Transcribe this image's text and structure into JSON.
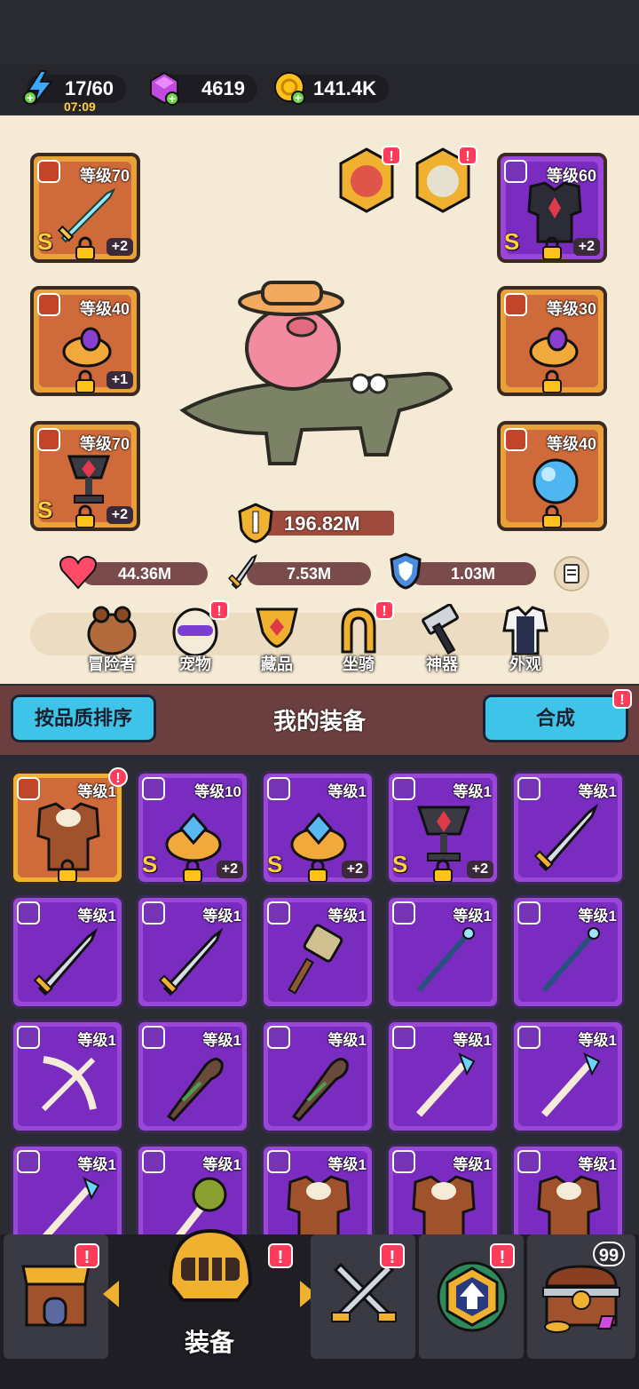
{
  "colors": {
    "accent_blue": "#3ec4e8",
    "purple_rarity": "#9a47d8",
    "orange_rarity": "#e9a13a",
    "alert_red": "#ff3b5c"
  },
  "resources": {
    "energy": {
      "value": "17/60",
      "timer": "07:09",
      "icon": "lightning-icon"
    },
    "gems": {
      "value": "4619",
      "icon": "gem-icon"
    },
    "gold": {
      "value": "141.4K",
      "icon": "coin-icon"
    }
  },
  "equipped": {
    "left": [
      {
        "level": "等级70",
        "rarity": "S",
        "plus": "+2",
        "type": "sword-icon"
      },
      {
        "level": "等级40",
        "rarity": "",
        "plus": "+1",
        "type": "ring-icon"
      },
      {
        "level": "等级70",
        "rarity": "S",
        "plus": "+2",
        "type": "amulet-icon"
      }
    ],
    "right": [
      {
        "level": "等级60",
        "rarity": "S",
        "plus": "+2",
        "type": "armor-icon"
      },
      {
        "level": "等级30",
        "rarity": "",
        "plus": "",
        "type": "ring-icon"
      },
      {
        "level": "等级40",
        "rarity": "",
        "plus": "",
        "type": "amulet-icon"
      }
    ]
  },
  "power": "196.82M",
  "stats": {
    "hp": "44.36M",
    "attack": "7.53M",
    "defense": "1.03M"
  },
  "categories": [
    {
      "label": "冒险者",
      "alert": false
    },
    {
      "label": "宠物",
      "alert": true
    },
    {
      "label": "藏品",
      "alert": false
    },
    {
      "label": "坐骑",
      "alert": true
    },
    {
      "label": "神器",
      "alert": false
    },
    {
      "label": "外观",
      "alert": false
    }
  ],
  "sort_button": "按品质排序",
  "section_title": "我的装备",
  "merge_button": "合成",
  "alert_mark": "!",
  "inventory": [
    {
      "level": "等级1",
      "rarity": "",
      "plus": "",
      "color": "orange",
      "lock": true,
      "alert": true
    },
    {
      "level": "等级10",
      "rarity": "S",
      "plus": "+2",
      "color": "purple",
      "lock": true,
      "alert": false
    },
    {
      "level": "等级1",
      "rarity": "S",
      "plus": "+2",
      "color": "purple",
      "lock": true,
      "alert": false
    },
    {
      "level": "等级1",
      "rarity": "S",
      "plus": "+2",
      "color": "purple",
      "lock": true,
      "alert": false
    },
    {
      "level": "等级1",
      "rarity": "",
      "plus": "",
      "color": "purple",
      "lock": false,
      "alert": false
    },
    {
      "level": "等级1",
      "rarity": "",
      "plus": "",
      "color": "purple",
      "lock": false,
      "alert": false
    },
    {
      "level": "等级1",
      "rarity": "",
      "plus": "",
      "color": "purple",
      "lock": false,
      "alert": false
    },
    {
      "level": "等级1",
      "rarity": "",
      "plus": "",
      "color": "purple",
      "lock": false,
      "alert": false
    },
    {
      "level": "等级1",
      "rarity": "",
      "plus": "",
      "color": "purple",
      "lock": false,
      "alert": false
    },
    {
      "level": "等级1",
      "rarity": "",
      "plus": "",
      "color": "purple",
      "lock": false,
      "alert": false
    },
    {
      "level": "等级1",
      "rarity": "",
      "plus": "",
      "color": "purple",
      "lock": false,
      "alert": false
    },
    {
      "level": "等级1",
      "rarity": "",
      "plus": "",
      "color": "purple",
      "lock": false,
      "alert": false
    },
    {
      "level": "等级1",
      "rarity": "",
      "plus": "",
      "color": "purple",
      "lock": false,
      "alert": false
    },
    {
      "level": "等级1",
      "rarity": "",
      "plus": "",
      "color": "purple",
      "lock": false,
      "alert": false
    },
    {
      "level": "等级1",
      "rarity": "",
      "plus": "",
      "color": "purple",
      "lock": false,
      "alert": false
    },
    {
      "level": "等级1",
      "rarity": "",
      "plus": "",
      "color": "purple",
      "lock": false,
      "alert": false
    },
    {
      "level": "等级1",
      "rarity": "",
      "plus": "",
      "color": "purple",
      "lock": false,
      "alert": false
    },
    {
      "level": "等级1",
      "rarity": "",
      "plus": "",
      "color": "purple",
      "lock": false,
      "alert": false
    },
    {
      "level": "等级1",
      "rarity": "",
      "plus": "",
      "color": "purple",
      "lock": false,
      "alert": false
    },
    {
      "level": "等级1",
      "rarity": "",
      "plus": "",
      "color": "purple",
      "lock": false,
      "alert": false
    }
  ],
  "bottom_nav": [
    {
      "label": "",
      "icon": "shop-icon",
      "alert": true
    },
    {
      "label": "装备",
      "icon": "helmet-icon",
      "alert": true,
      "active": true
    },
    {
      "label": "",
      "icon": "battle-icon",
      "alert": true
    },
    {
      "label": "",
      "icon": "upgrade-icon",
      "alert": true
    },
    {
      "label": "",
      "icon": "chest-icon",
      "count": "99"
    }
  ]
}
